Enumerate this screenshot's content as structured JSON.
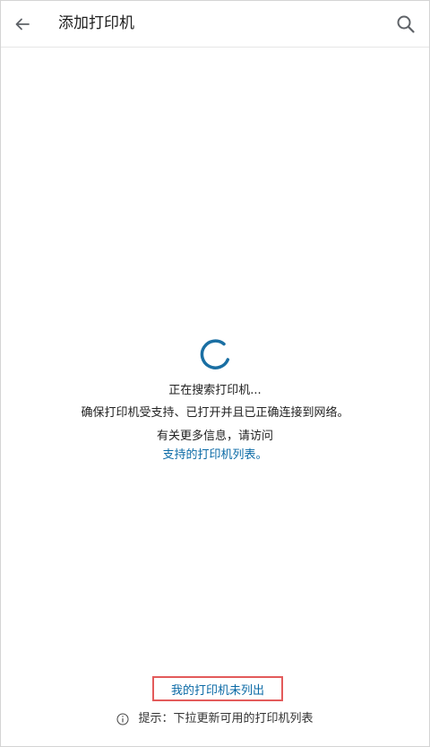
{
  "header": {
    "back_icon": "arrow-left-icon",
    "title": "添加打印机",
    "search_icon": "search-icon"
  },
  "status": {
    "spinner_icon": "loading-spinner-icon",
    "searching": "正在搜索打印机...",
    "ensure": "确保打印机受支持、已打开并且已正确连接到网络。",
    "more_info": "有关更多信息，请访问",
    "supported_link": "支持的打印机列表。"
  },
  "footer": {
    "not_listed": "我的打印机未列出",
    "hint_icon": "info-icon",
    "hint": "提示：下拉更新可用的打印机列表"
  },
  "colors": {
    "accent": "#0b6aa6",
    "highlight_border": "#e35b5b",
    "text": "#222222"
  }
}
